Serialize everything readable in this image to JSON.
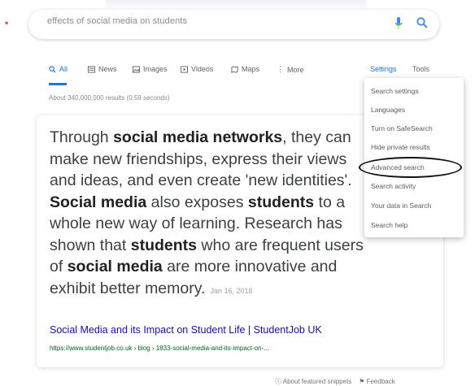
{
  "search": {
    "query": "effects of social media on students"
  },
  "tabs": {
    "all": "All",
    "news": "News",
    "images": "Images",
    "videos": "Videos",
    "maps": "Maps",
    "more": "More",
    "settings": "Settings",
    "tools": "Tools"
  },
  "result_stats": "About 340,000,000 results (0.59 seconds)",
  "snippet": {
    "t1": "Through ",
    "b1": "social media networks",
    "t2": ", they can make new friendships, express their views and ideas, and even create 'new identities'. ",
    "b2": "Social media",
    "t3": " also exposes ",
    "b3": "students",
    "t4": " to a whole new way of learning. Research has shown that ",
    "b4": "students",
    "t5": " who are frequent users of ",
    "b5": "social media",
    "t6": " are more innovative and exhibit better memory.",
    "date": "Jan 16, 2018"
  },
  "result": {
    "title": "Social Media and its Impact on Student Life | StudentJob UK",
    "url": "https://www.studentjob.co.uk › blog › 1833-social-media-and-its-impact-on-..."
  },
  "settings_menu": {
    "items": [
      "Search settings",
      "Languages",
      "Turn on SafeSearch",
      "Hide private results",
      "Advanced search",
      "Search activity",
      "Your data in Search",
      "Search help"
    ]
  },
  "footer": {
    "about": "About featured snippets",
    "feedback": "Feedback"
  },
  "colors": {
    "accent": "#1a73e8",
    "link": "#1a0dab",
    "url": "#006621"
  }
}
